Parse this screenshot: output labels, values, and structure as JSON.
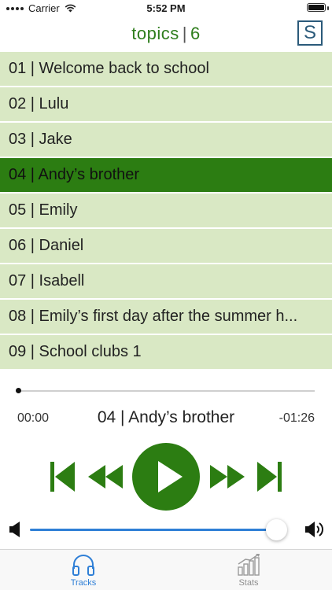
{
  "status_bar": {
    "carrier": "Carrier",
    "time": "5:52 PM"
  },
  "header": {
    "title_word": "topics",
    "separator": "|",
    "title_number": "6",
    "logo_letter": "S"
  },
  "tracks": [
    {
      "label": "01 | Welcome back to school",
      "active": false
    },
    {
      "label": "02 | Lulu",
      "active": false
    },
    {
      "label": "03 | Jake",
      "active": false
    },
    {
      "label": "04 | Andy’s brother",
      "active": true
    },
    {
      "label": "05 | Emily",
      "active": false
    },
    {
      "label": "06 | Daniel",
      "active": false
    },
    {
      "label": "07 | Isabell",
      "active": false
    },
    {
      "label": "08 | Emily’s first day after the summer h...",
      "active": false
    },
    {
      "label": "09 | School clubs 1",
      "active": false
    }
  ],
  "player": {
    "elapsed": "00:00",
    "remaining": "-01:26",
    "now_playing": "04 | Andy’s brother",
    "progress_fraction": 0.0,
    "volume_fraction": 0.96
  },
  "tab_bar": {
    "tabs": [
      {
        "label": "Tracks",
        "icon": "headphones-icon",
        "selected": true
      },
      {
        "label": "Stats",
        "icon": "bar-chart-icon",
        "selected": false
      }
    ]
  },
  "colors": {
    "accent_green": "#2c7d12",
    "row_green": "#d9e8c4",
    "blue": "#2f7fd6"
  }
}
